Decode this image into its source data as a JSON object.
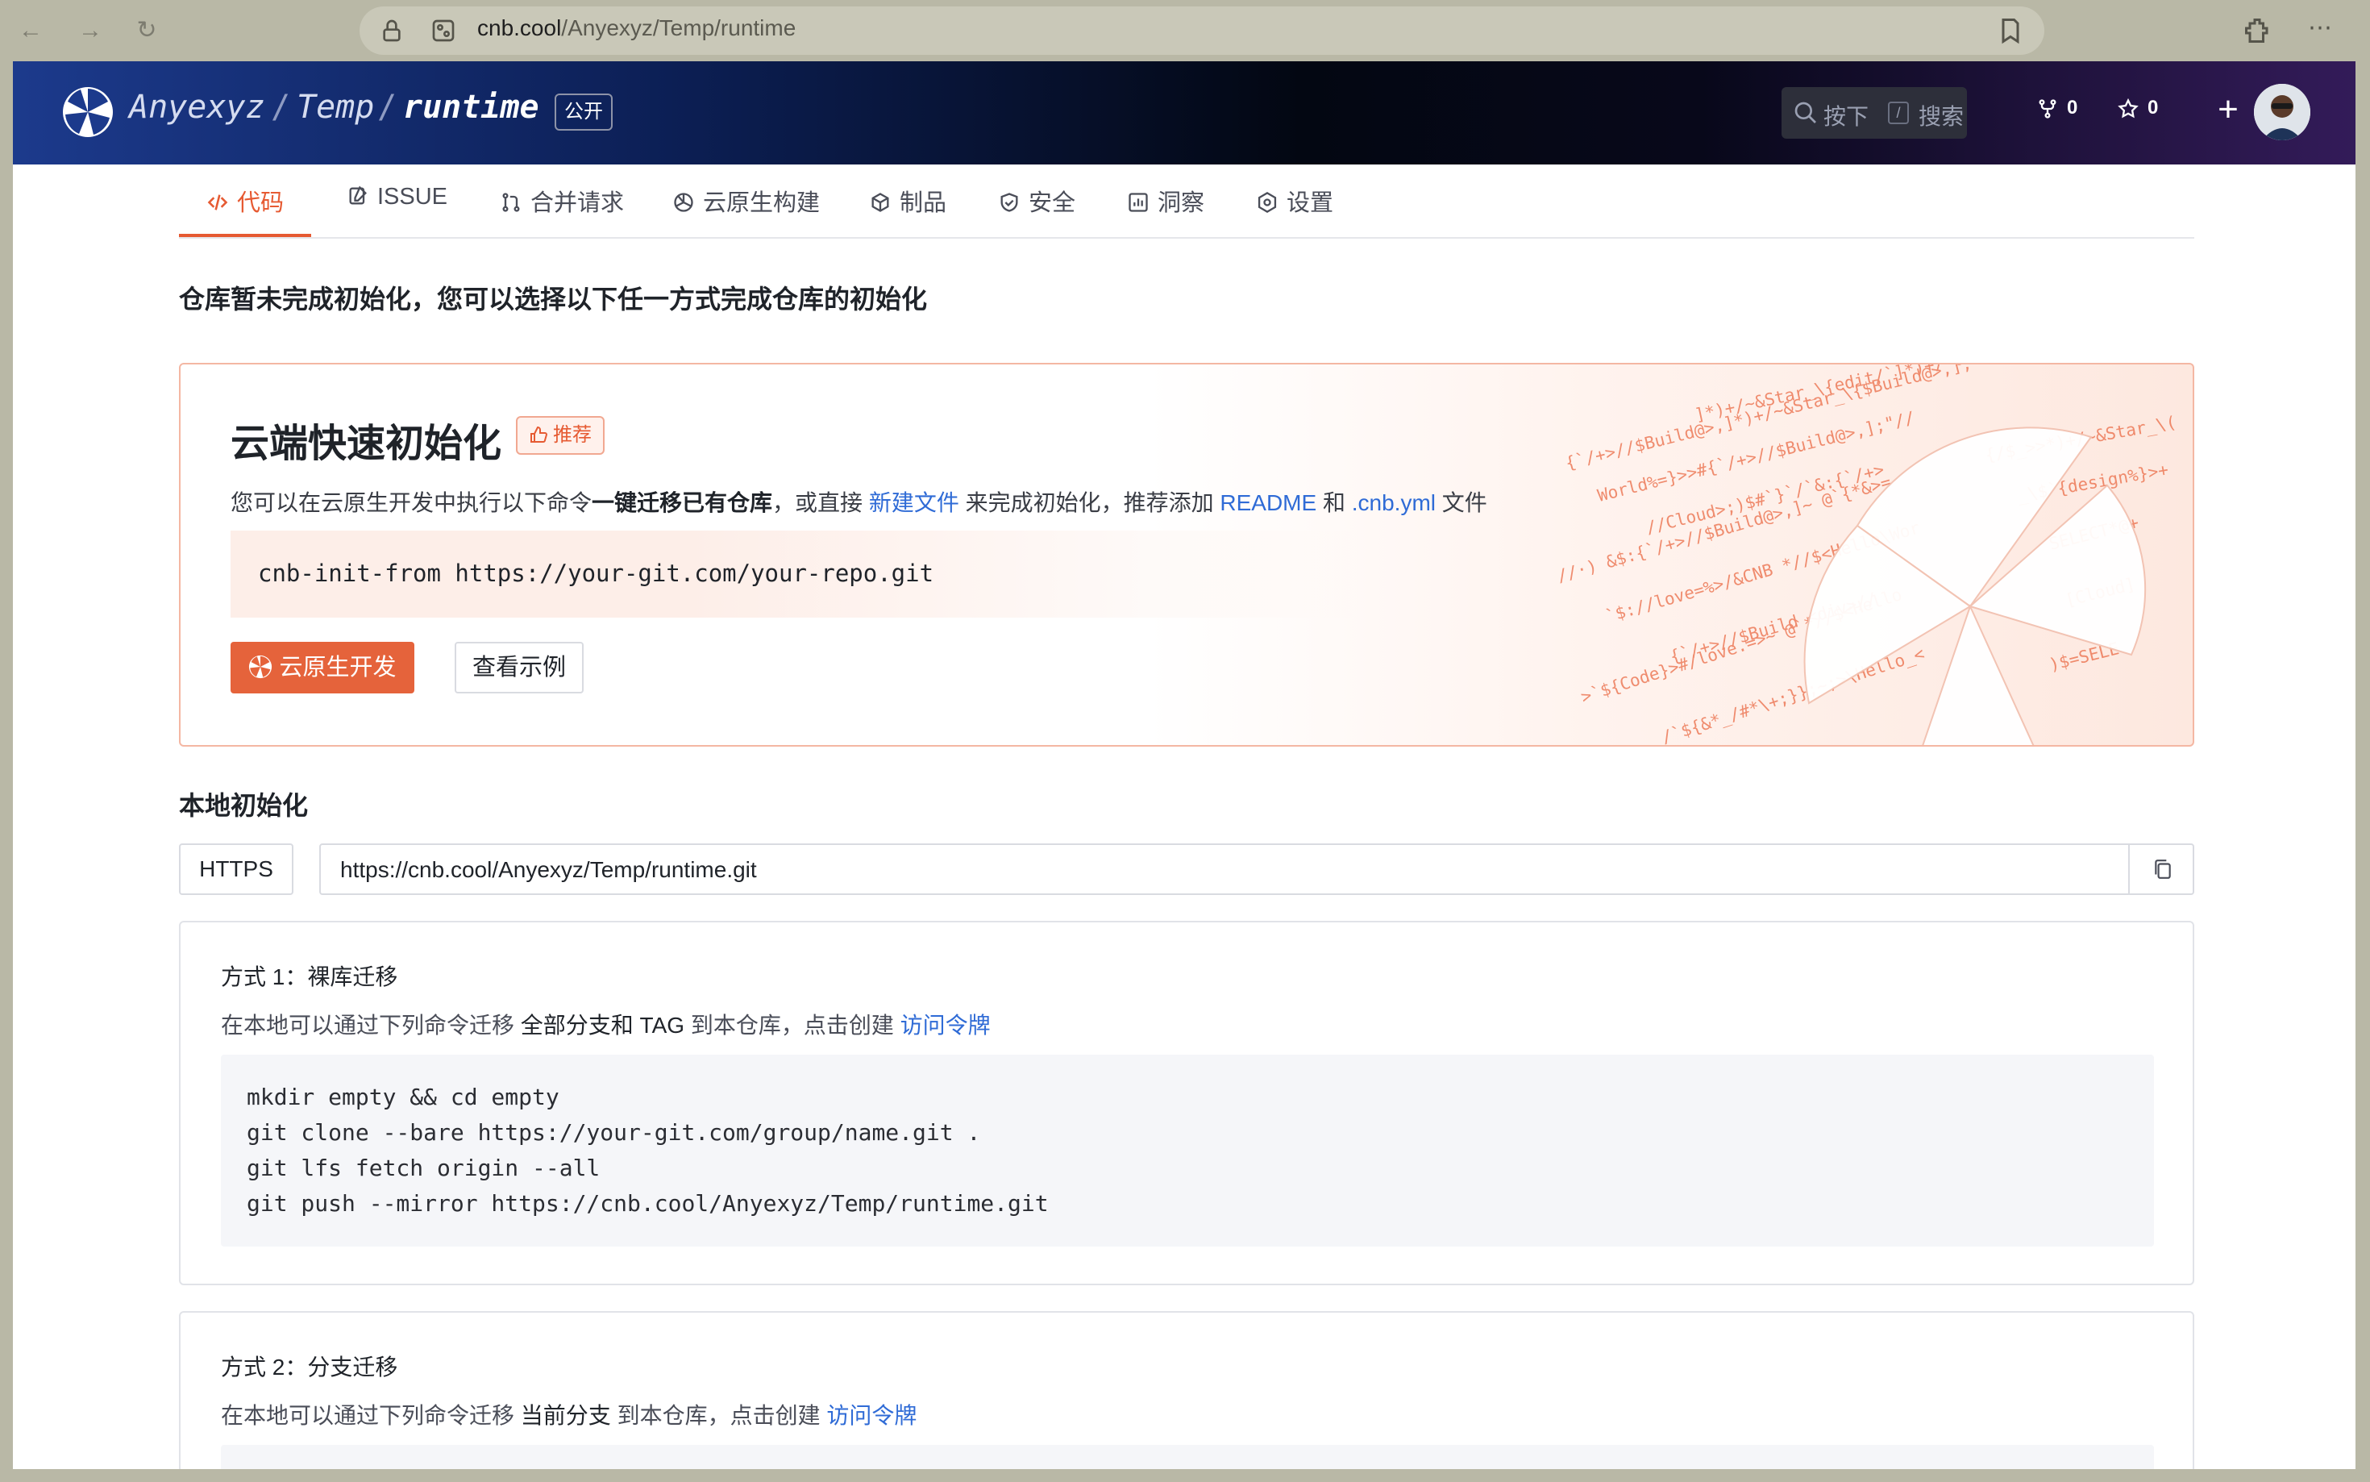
{
  "browser": {
    "url_host": "cnb.cool",
    "url_path": "/Anyexyz/Temp/runtime"
  },
  "header": {
    "owner": "Anyexyz",
    "group": "Temp",
    "repo": "runtime",
    "separator": "/",
    "visibility": "公开",
    "search_prefix": "按下",
    "search_key": "/",
    "search_label": "搜索",
    "fork_count": "0",
    "star_count": "0",
    "add_symbol": "+"
  },
  "tabs": [
    {
      "label": "代码",
      "icon": "code-icon",
      "active": true
    },
    {
      "label": "ISSUE",
      "icon": "issue-icon"
    },
    {
      "label": "合并请求",
      "icon": "pull-request-icon"
    },
    {
      "label": "云原生构建",
      "icon": "build-icon"
    },
    {
      "label": "制品",
      "icon": "package-icon"
    },
    {
      "label": "安全",
      "icon": "shield-icon"
    },
    {
      "label": "洞察",
      "icon": "chart-icon"
    },
    {
      "label": "设置",
      "icon": "gear-icon"
    }
  ],
  "notice": "仓库暂未完成初始化，您可以选择以下任一方式完成仓库的初始化",
  "quick_init": {
    "title": "云端快速初始化",
    "badge": "推荐",
    "desc_1": "您可以在云原生开发中执行以下命令",
    "desc_bold": "一键迁移已有仓库",
    "desc_2": "，或直接 ",
    "link_new_file": "新建文件",
    "desc_3": " 来完成初始化，推荐添加 ",
    "link_readme": "README",
    "desc_4": " 和 ",
    "link_cnb_yml": ".cnb.yml",
    "desc_5": " 文件",
    "command": "cnb-init-from https://your-git.com/your-repo.git",
    "primary_button": "云原生开发",
    "secondary_button": "查看示例"
  },
  "local_init": {
    "title": "本地初始化",
    "protocol": "HTTPS",
    "clone_url": "https://cnb.cool/Anyexyz/Temp/runtime.git",
    "method1": {
      "title": "方式 1：裸库迁移",
      "desc_1": "在本地可以通过下列命令迁移 ",
      "desc_bold": "全部分支和 TAG",
      "desc_2": " 到本仓库，点击创建 ",
      "link": "访问令牌",
      "code": [
        "mkdir empty && cd empty",
        "git clone --bare https://your-git.com/group/name.git .",
        "git lfs fetch origin --all",
        "git push --mirror https://cnb.cool/Anyexyz/Temp/runtime.git"
      ]
    },
    "method2": {
      "title": "方式 2：分支迁移",
      "desc_1": "在本地可以通过下列命令迁移 ",
      "desc_bold": "当前分支",
      "desc_2": " 到本仓库，点击创建 ",
      "link": "访问令牌"
    }
  },
  "colors": {
    "accent": "#e65a32",
    "link": "#2f6bd6"
  }
}
